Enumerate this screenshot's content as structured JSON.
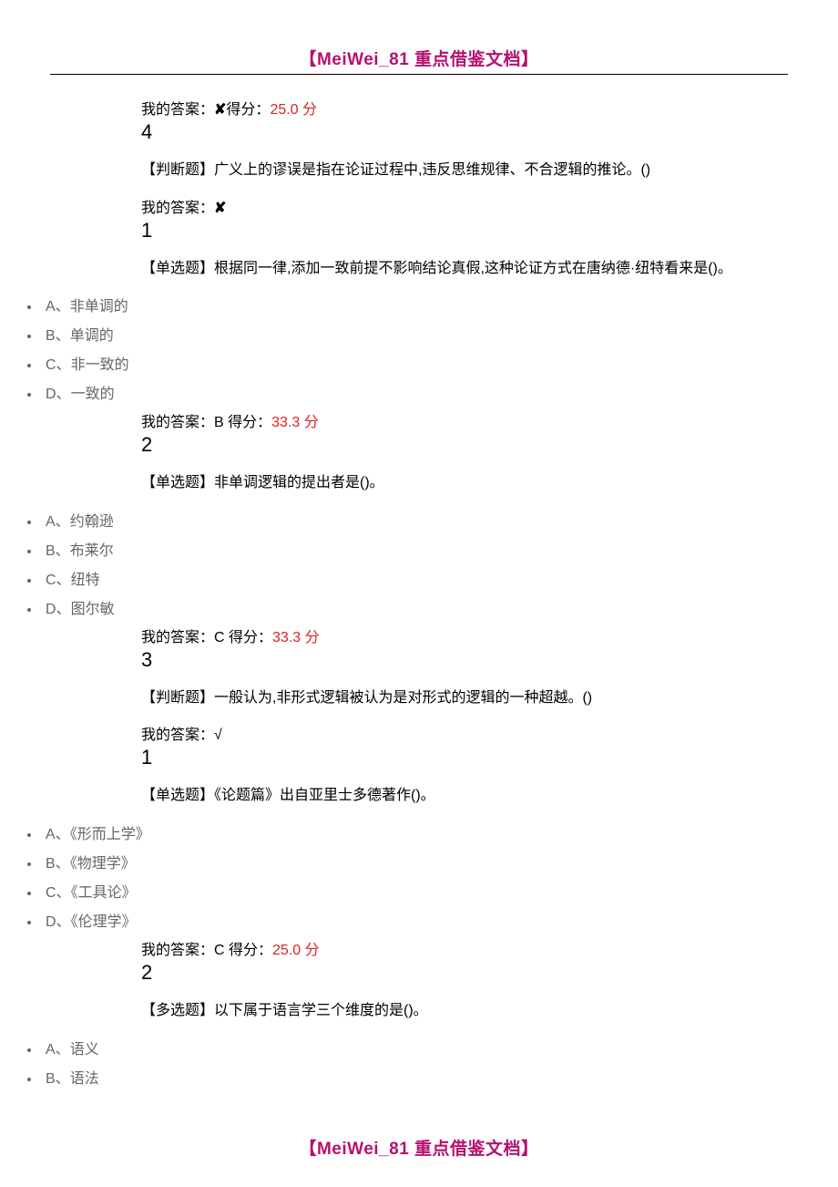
{
  "header": "【MeiWei_81 重点借鉴文档】",
  "footer": "【MeiWei_81 重点借鉴文档】",
  "blocks": [
    {
      "answer_prefix": "我的答案：",
      "answer_symbol": "✘",
      "score_prefix": "得分：",
      "score": "25.0 分",
      "number": "4"
    },
    {
      "question": "【判断题】广义上的谬误是指在论证过程中,违反思维规律、不合逻辑的推论。()",
      "answer_prefix": "我的答案：",
      "answer_symbol": "✘",
      "number": "1"
    },
    {
      "question": "【单选题】根据同一律,添加一致前提不影响结论真假,这种论证方式在唐纳德·纽特看来是()。",
      "options": [
        {
          "label": "A、",
          "text": "非单调的"
        },
        {
          "label": "B、",
          "text": "单调的"
        },
        {
          "label": "C、",
          "text": "非一致的"
        },
        {
          "label": "D、",
          "text": "一致的"
        }
      ],
      "answer_prefix": "我的答案：",
      "answer_value": "B",
      "score_prefix": " 得分：",
      "score": "33.3 分",
      "number": "2"
    },
    {
      "question": "【单选题】非单调逻辑的提出者是()。",
      "options": [
        {
          "label": "A、",
          "text": "约翰逊"
        },
        {
          "label": "B、",
          "text": "布莱尔"
        },
        {
          "label": "C、",
          "text": "纽特"
        },
        {
          "label": "D、",
          "text": "图尔敏"
        }
      ],
      "answer_prefix": "我的答案：",
      "answer_value": "C",
      "score_prefix": " 得分：",
      "score": "33.3 分",
      "number": "3"
    },
    {
      "question": "【判断题】一般认为,非形式逻辑被认为是对形式的逻辑的一种超越。()",
      "answer_prefix": "我的答案：",
      "answer_symbol": "√",
      "number": "1"
    },
    {
      "question": "【单选题】《论题篇》出自亚里士多德著作()。",
      "options": [
        {
          "label": "A、",
          "text": "《形而上学》"
        },
        {
          "label": "B、",
          "text": "《物理学》"
        },
        {
          "label": "C、",
          "text": "《工具论》"
        },
        {
          "label": "D、",
          "text": "《伦理学》"
        }
      ],
      "answer_prefix": "我的答案：",
      "answer_value": "C",
      "score_prefix": " 得分：",
      "score": "25.0 分",
      "number": "2"
    },
    {
      "question": "【多选题】以下属于语言学三个维度的是()。",
      "options_partial": [
        {
          "label": "A、",
          "text": "语义"
        },
        {
          "label": "B、",
          "text": "语法"
        }
      ]
    }
  ]
}
